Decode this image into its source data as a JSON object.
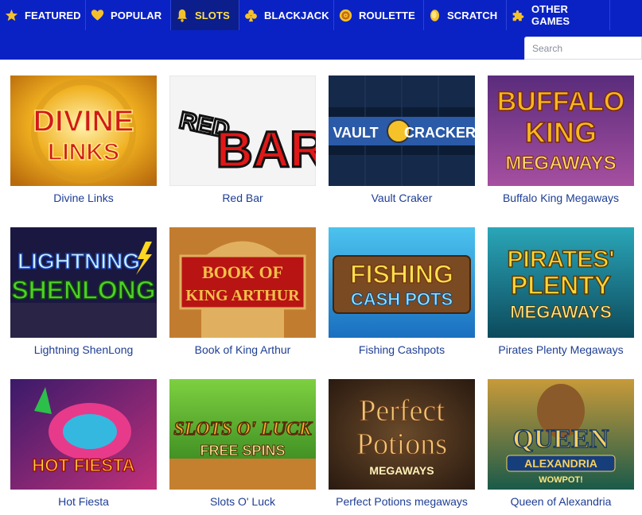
{
  "nav": {
    "items": [
      {
        "label": "FEATURED",
        "icon": "star-icon",
        "active": false
      },
      {
        "label": "POPULAR",
        "icon": "heart-icon",
        "active": false
      },
      {
        "label": "SLOTS",
        "icon": "bell-icon",
        "active": true
      },
      {
        "label": "BLACKJACK",
        "icon": "club-icon",
        "active": false
      },
      {
        "label": "ROULETTE",
        "icon": "roulette-icon",
        "active": false
      },
      {
        "label": "SCRATCH",
        "icon": "coin-icon",
        "active": false
      },
      {
        "label": "OTHER GAMES",
        "icon": "puzzle-icon",
        "active": false
      }
    ]
  },
  "search": {
    "placeholder": "Search"
  },
  "games": [
    {
      "title": "Divine Links",
      "art_lines": [
        "DIVINE",
        "LINKS"
      ]
    },
    {
      "title": "Red Bar",
      "art_lines": [
        "RED",
        "BAR"
      ]
    },
    {
      "title": "Vault Craker",
      "art_lines": [
        "VAULT",
        "CRACKER"
      ]
    },
    {
      "title": "Buffalo King Megaways",
      "art_lines": [
        "BUFFALO",
        "KING",
        "MEGAWAYS"
      ]
    },
    {
      "title": "Lightning ShenLong",
      "art_lines": [
        "LIGHTNING",
        "SHENLONG"
      ]
    },
    {
      "title": "Book of King Arthur",
      "art_lines": [
        "BOOK OF",
        "KING ARTHUR"
      ]
    },
    {
      "title": "Fishing Cashpots",
      "art_lines": [
        "FISHING",
        "CASH POTS"
      ]
    },
    {
      "title": "Pirates Plenty Megaways",
      "art_lines": [
        "PIRATES'",
        "PLENTY",
        "MEGAWAYS"
      ]
    },
    {
      "title": "Hot Fiesta",
      "art_lines": [
        "HOT FIESTA"
      ]
    },
    {
      "title": "Slots O' Luck",
      "art_lines": [
        "SLOTS O' LUCK",
        "FREE SPINS"
      ]
    },
    {
      "title": "Perfect Potions megaways",
      "art_lines": [
        "Perfect",
        "Potions",
        "MEGAWAYS"
      ]
    },
    {
      "title": "Queen of Alexandria",
      "art_lines": [
        "QUEEN",
        "ALEXANDRIA",
        "WOWPOT!"
      ]
    }
  ],
  "colors": {
    "topbar": "#0a22c4",
    "active_tab": "#0b1e8c",
    "active_text": "#ffe24a",
    "caption": "#1e3e94",
    "icon_gold": "#f4c12b"
  }
}
